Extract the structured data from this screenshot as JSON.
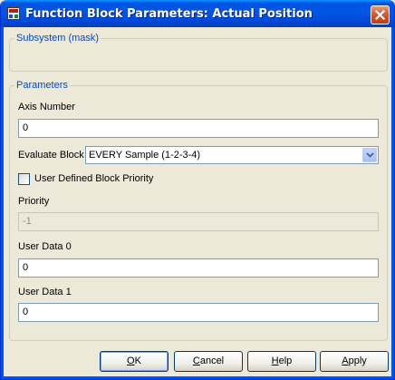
{
  "window": {
    "title": "Function Block Parameters: Actual Position"
  },
  "subsystem_group": {
    "legend": "Subsystem (mask)"
  },
  "parameters_group": {
    "legend": "Parameters",
    "axis_number": {
      "label": "Axis Number",
      "value": "0"
    },
    "evaluate_block": {
      "label": "Evaluate Block",
      "selected": "EVERY Sample (1-2-3-4)"
    },
    "user_defined_priority": {
      "label": "User Defined Block Priority",
      "checked": false
    },
    "priority": {
      "label": "Priority",
      "value": "-1",
      "enabled": false
    },
    "user_data_0": {
      "label": "User Data 0",
      "value": "0"
    },
    "user_data_1": {
      "label": "User Data 1",
      "value": "0"
    }
  },
  "buttons": {
    "ok": {
      "label": "OK",
      "underline": "O",
      "rest": "K"
    },
    "cancel": {
      "label": "Cancel",
      "underline": "C",
      "rest": "ancel"
    },
    "help": {
      "label": "Help",
      "underline": "H",
      "rest": "elp"
    },
    "apply": {
      "label": "Apply",
      "underline": "A",
      "rest": "pply"
    }
  },
  "icons": {
    "app": "simulink-block-icon",
    "close": "close-icon",
    "dropdown": "chevron-down-icon"
  },
  "colors": {
    "titlebar": "#0055e5",
    "legend_text": "#0046d5",
    "dialog_bg": "#ece9d8",
    "close_button": "#d8582b"
  }
}
